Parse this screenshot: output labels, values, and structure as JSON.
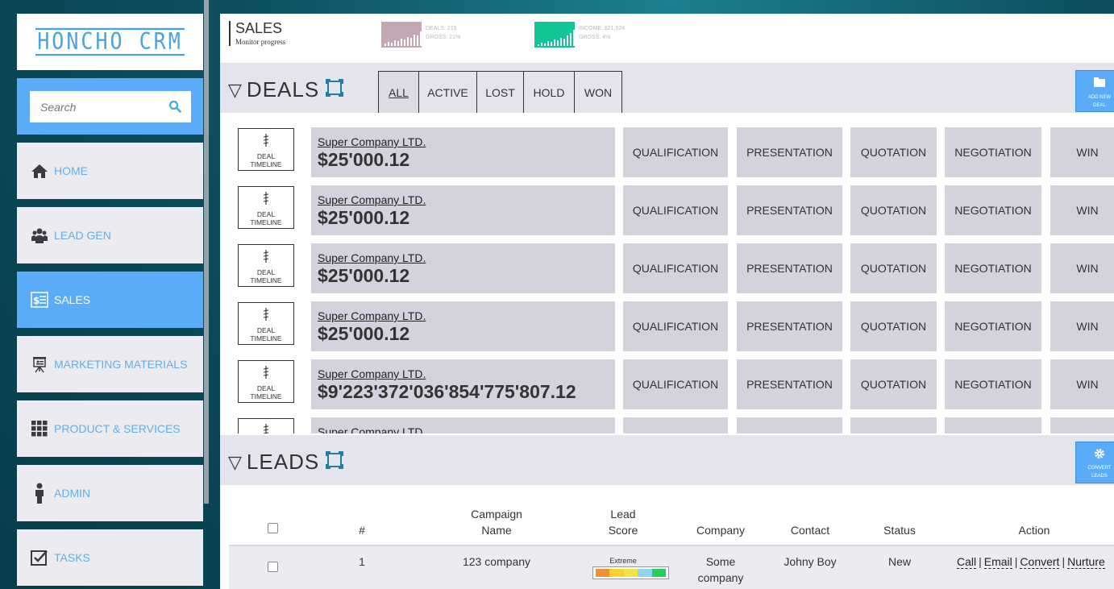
{
  "app": {
    "logo": "HONCHO CRM"
  },
  "search": {
    "placeholder": "Search"
  },
  "nav": [
    {
      "label": "HOME",
      "icon": "home-icon"
    },
    {
      "label": "LEAD GEN",
      "icon": "group-icon"
    },
    {
      "label": "SALES",
      "icon": "sales-icon",
      "active": true
    },
    {
      "label": "MARKETING MATERIALS",
      "icon": "presentation-icon"
    },
    {
      "label": "PRODUCT & SERVICES",
      "icon": "grid-icon"
    },
    {
      "label": "ADMIN",
      "icon": "person-icon"
    },
    {
      "label": "TASKS",
      "icon": "checkbox-icon"
    }
  ],
  "header": {
    "title": "SALES",
    "subtitle": "Monitor progress",
    "stat1": {
      "line1": "DEALS: 215",
      "line2": "GROSS: 21%",
      "color": "#c4a7b5"
    },
    "stat2": {
      "line1": "INCOME: $21,524",
      "line2": "GROSS: 4%",
      "color": "#12c596"
    }
  },
  "deals": {
    "title": "DEALS",
    "filters": [
      "ALL",
      "ACTIVE",
      "LOST",
      "HOLD",
      "WON"
    ],
    "add_label_1": "ADD NEW",
    "add_label_2": "DEAL",
    "timeline_label_1": "DEAL",
    "timeline_label_2": "TIMELINE",
    "stages": [
      "QUALIFICATION",
      "PRESENTATION",
      "QUOTATION",
      "NEGOTIATION",
      "WIN"
    ],
    "rows": [
      {
        "company": "Super Company LTD.",
        "amount": "$25'000.12"
      },
      {
        "company": "Super Company LTD.",
        "amount": "$25'000.12"
      },
      {
        "company": "Super Company LTD.",
        "amount": "$25'000.12"
      },
      {
        "company": "Super Company LTD.",
        "amount": "$25'000.12"
      },
      {
        "company": "Super Company LTD.",
        "amount": "$9'223'372'036'854'775'807.12"
      },
      {
        "company": "Super Company LTD.",
        "amount": ""
      }
    ]
  },
  "leads": {
    "title": "LEADS",
    "convert_label_1": "CONVERT",
    "convert_label_2": "LEADS",
    "columns": {
      "num": "#",
      "campaign_1": "Campaign",
      "campaign_2": "Name",
      "score_1": "Lead",
      "score_2": "Score",
      "company": "Company",
      "contact": "Contact",
      "status": "Status",
      "action": "Action"
    },
    "rows": [
      {
        "num": "1",
        "campaign": "123 company",
        "score_label": "Extreme",
        "score": 5,
        "company_1": "Some",
        "company_2": "company",
        "contact": "Johny Boy",
        "status": "New",
        "actions": [
          "Call",
          "Email",
          "Convert",
          "Nurture"
        ]
      }
    ],
    "score_colors": [
      "#f0903a",
      "#f5d22f",
      "#f4e24a",
      "#8ed6f0",
      "#22d05a"
    ]
  },
  "colors": {
    "accent": "#5aabf8",
    "panel": "#e4e5ec",
    "cell": "#d2d3dc"
  }
}
